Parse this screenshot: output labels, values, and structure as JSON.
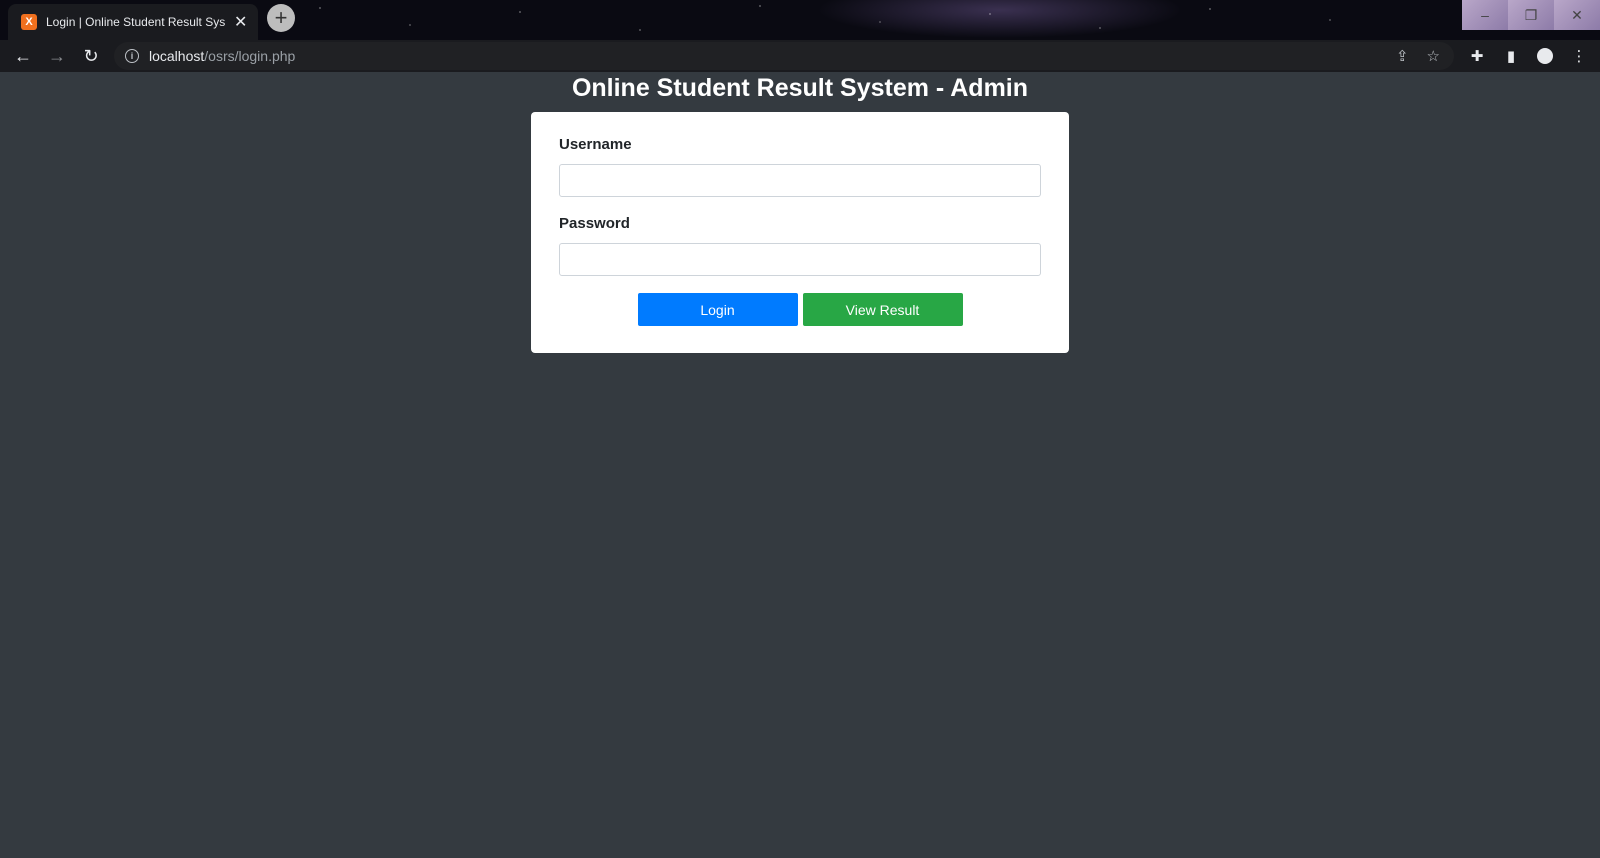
{
  "browser": {
    "tab": {
      "favicon": "X",
      "title": "Login | Online Student Result Sys",
      "close": "✕"
    },
    "new_tab": "+",
    "window_controls": [
      "–",
      "❐",
      "✕"
    ],
    "nav": {
      "back": "←",
      "forward": "→",
      "reload": "↻"
    },
    "address": {
      "host": "localhost",
      "path": "/osrs/login.php"
    },
    "omnibox_icons": {
      "share": "⇪",
      "bookmark": "☆"
    },
    "toolbar_icons": {
      "extensions": "✚",
      "sidepanel": "▮",
      "menu": "⋮"
    }
  },
  "page": {
    "title": "Online Student Result System - Admin",
    "form": {
      "username_label": "Username",
      "username_value": "",
      "password_label": "Password",
      "password_value": "",
      "login_label": "Login",
      "view_result_label": "View Result"
    }
  },
  "colors": {
    "background": "#343a40",
    "login_button": "#007bff",
    "view_result_button": "#28a745"
  }
}
